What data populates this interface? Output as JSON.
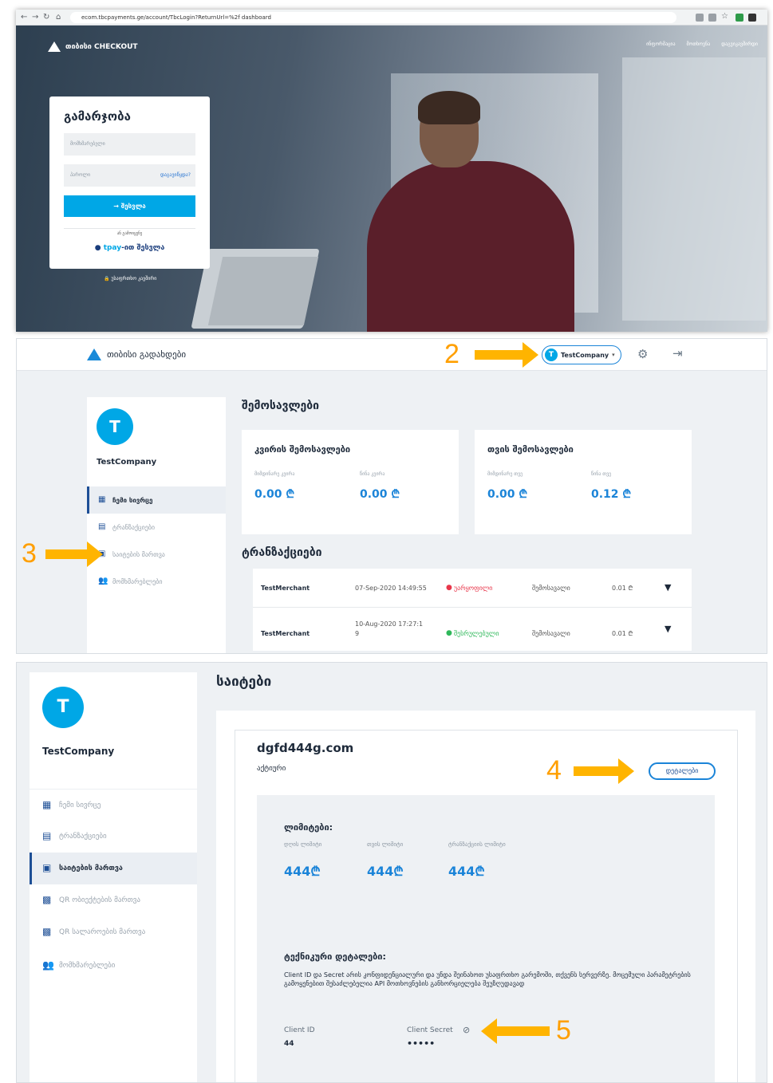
{
  "panel1": {
    "browser_url": "ecom.tbcpayments.ge/account/TbcLogin?ReturnUrl=%2f dashboard",
    "brand": "თიბისი CHECKOUT",
    "top_links": [
      "ინფორმაცია",
      "მოთხოვნა",
      "დაგვიკავშირდი"
    ],
    "login": {
      "title": "გამარჯობა",
      "username_placeholder": "მომხმარებელი",
      "password_placeholder": "პაროლი",
      "forgot_link": "დაგავიწყდა?",
      "submit_label": "→ შესვლა",
      "or_text": "ან გამოიყენე",
      "tpay_brand": "tpay",
      "tpay_suffix": "-ით შესვლა"
    },
    "secure_text": "უსაფრთხო კავშირი"
  },
  "panel2": {
    "brand": "თიბისი გადახდები",
    "company": "TestCompany",
    "company_initial": "T",
    "callout_2": "2",
    "callout_3": "3",
    "sidebar": {
      "avatar_initial": "T",
      "name": "TestCompany",
      "items": [
        {
          "label": "ჩემი სივრცე"
        },
        {
          "label": "ტრანზაქციები"
        },
        {
          "label": "საიტების მართვა"
        },
        {
          "label": "მომხმარებლები"
        }
      ]
    },
    "income_title": "შემოსავლები",
    "weekly": {
      "title": "კვირის შემოსავლები",
      "current_label": "მიმდინარე კვირა",
      "current_value": "0.00 ₾",
      "prev_label": "წინა კვირა",
      "prev_value": "0.00 ₾"
    },
    "monthly": {
      "title": "თვის შემოსავლები",
      "current_label": "მიმდინარე თვე",
      "current_value": "0.00 ₾",
      "prev_label": "წინა თვე",
      "prev_value": "0.12 ₾"
    },
    "transactions_title": "ტრანზაქციები",
    "transactions": [
      {
        "merchant": "TestMerchant",
        "date": "07-Sep-2020 14:49:55",
        "status": "უარყოფილი",
        "status_color": "#e8364a",
        "type": "შემოსავალი",
        "amount": "0.01 ₾"
      },
      {
        "merchant": "TestMerchant",
        "date": "10-Aug-2020 17:27:1",
        "date2": "9",
        "status": "შესრულებული",
        "status_color": "#2fb85a",
        "type": "შემოსავალი",
        "amount": "0.01 ₾"
      }
    ]
  },
  "panel3": {
    "sidebar": {
      "avatar_initial": "T",
      "name": "TestCompany",
      "items": [
        {
          "label": "ჩემი სივრცე"
        },
        {
          "label": "ტრანზაქციები"
        },
        {
          "label": "საიტების მართვა"
        },
        {
          "label": "QR ობიექტების მართვა"
        },
        {
          "label": "QR სალაროების მართვა"
        },
        {
          "label": "მომხმარებლები"
        }
      ]
    },
    "page_title": "საიტები",
    "site": {
      "domain": "dgfd444g.com",
      "status": "აქტიური",
      "details_button": "დეტალები"
    },
    "callout_4": "4",
    "callout_5": "5",
    "limits": {
      "title": "ლიმიტები:",
      "daily_label": "დღის ლიმიტი",
      "daily_value": "444₾",
      "monthly_label": "თვის ლიმიტი",
      "monthly_value": "444₾",
      "transaction_label": "ტრანზაქციის ლიმიტი",
      "transaction_value": "444₾"
    },
    "technical": {
      "title": "ტექნიკური დეტალები:",
      "description": "Client ID და Secret არის კონფიდენციალური და უნდა შეინახოთ უსაფრთხო გარემოში, თქვენს სერვერზე. მოცემული პარამეტრების გამოყენებით შესაძლებელია API მოთხოვნების განხორციელება შეუზღუდავად",
      "client_id_label": "Client ID",
      "client_id_value": "44",
      "client_secret_label": "Client Secret",
      "client_secret_value": "•••••"
    }
  }
}
